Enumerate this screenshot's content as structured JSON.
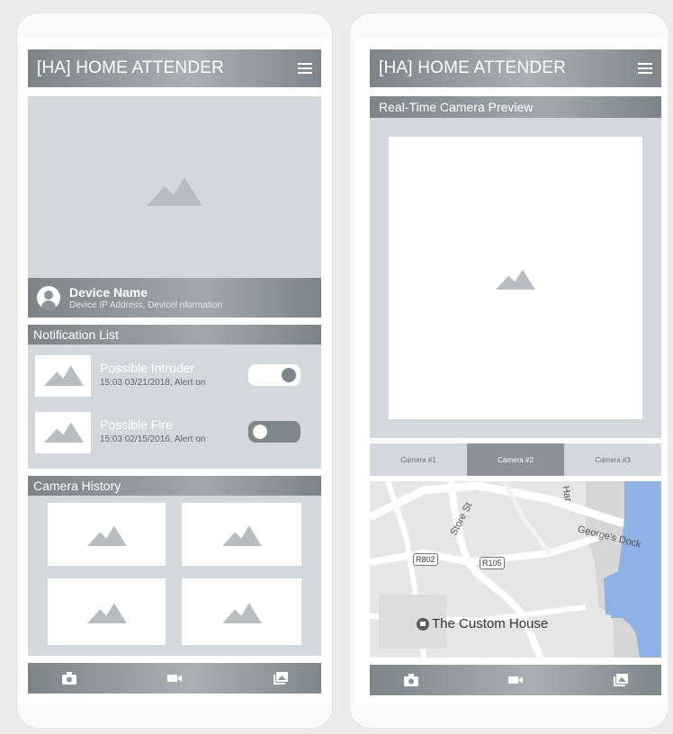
{
  "app": {
    "title": "[HA] HOME ATTENDER"
  },
  "home": {
    "device": {
      "name": "Device Name",
      "info": "Device IP Address, Devicel nformation"
    },
    "notifications": {
      "title": "Notification List",
      "items": [
        {
          "title": "Possible Intruder",
          "subtitle": "15:03 03/21/2018, Alert on",
          "toggle_on": true
        },
        {
          "title": "Possible Fire",
          "subtitle": "15:03 02/15/2016, Alert on",
          "toggle_on": false
        }
      ]
    },
    "history": {
      "title": "Camera History"
    }
  },
  "camera": {
    "preview_title": "Real-Time Camera Preview",
    "tabs": [
      {
        "label": "Camera #1",
        "active": false
      },
      {
        "label": "Camera #2",
        "active": true
      },
      {
        "label": "Camera #3",
        "active": false
      }
    ],
    "map": {
      "street_store": "Store St",
      "street_hare": "Har",
      "street_george": "George's Dock",
      "route_1": "R802",
      "route_2": "R105",
      "place": "The Custom House"
    }
  },
  "nav": {
    "icons": [
      "camera-icon",
      "video-icon",
      "gallery-icon"
    ]
  },
  "colors": {
    "header": "#8b9398",
    "placeholder": "#d2d8db",
    "water": "#8fb1e6"
  }
}
